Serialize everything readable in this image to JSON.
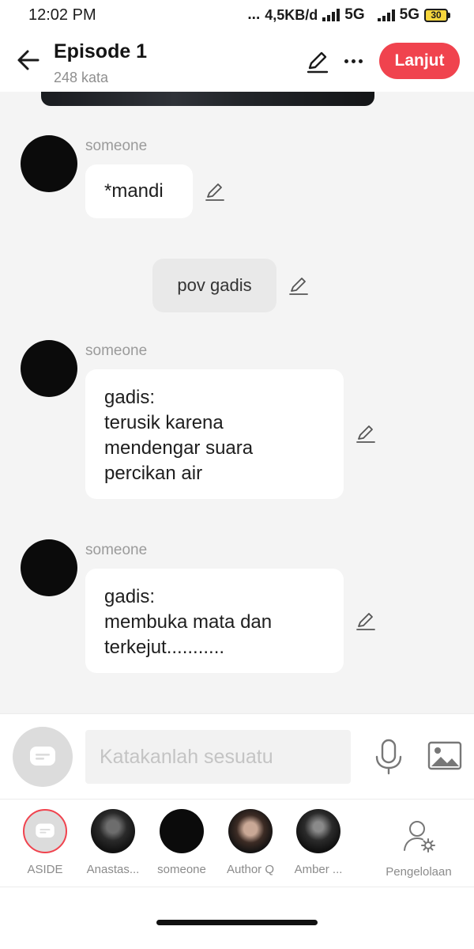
{
  "status_bar": {
    "time": "12:02 PM",
    "dots": "...",
    "speed": "4,5KB/d",
    "network1": "5G",
    "network2": "5G",
    "battery": "30"
  },
  "header": {
    "title": "Episode 1",
    "subtitle": "248 kata",
    "next_label": "Lanjut"
  },
  "messages": [
    {
      "type": "character",
      "sender": "someone",
      "text": "*mandi"
    },
    {
      "type": "narration",
      "text": "pov gadis"
    },
    {
      "type": "character",
      "sender": "someone",
      "text": "gadis:\nterusik karena\nmendengar suara\npercikan air"
    },
    {
      "type": "character",
      "sender": "someone",
      "text": "gadis:\nmembuka mata dan\nterkejut..........."
    }
  ],
  "input": {
    "placeholder": "Katakanlah sesuatu"
  },
  "characters": [
    {
      "label": "ASIDE"
    },
    {
      "label": "Anastas..."
    },
    {
      "label": "someone"
    },
    {
      "label": "Author Q"
    },
    {
      "label": "Amber ..."
    }
  ],
  "management": {
    "label": "Pengelolaan"
  },
  "colors": {
    "accent": "#f0434e",
    "background": "#f4f4f4"
  }
}
